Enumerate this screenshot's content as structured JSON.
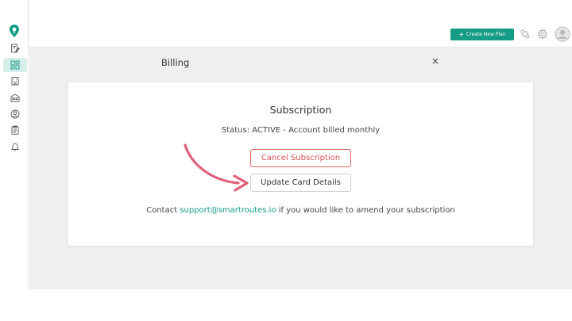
{
  "topbar": {
    "create_button_label": "Create New Plan"
  },
  "panel": {
    "title": "Billing",
    "close_glyph": "×"
  },
  "subscription": {
    "title": "Subscription",
    "status": "Status: ACTIVE - Account billed monthly",
    "cancel_label": "Cancel Subscription",
    "update_label": "Update Card Details",
    "contact_prefix": "Contact ",
    "contact_email": "support@smartroutes.io",
    "contact_suffix": " if you would like to amend your subscription"
  },
  "colors": {
    "accent": "#169c86",
    "danger": "#dd4f4f",
    "annotation_arrow": "#e0607a",
    "nav_active_bg": "#d6eeea"
  },
  "sidebar": {
    "items": [
      {
        "icon": "edit-document-icon",
        "active": false
      },
      {
        "icon": "dashboard-grid-icon",
        "active": true
      },
      {
        "icon": "building-icon",
        "active": false
      },
      {
        "icon": "warehouse-icon",
        "active": false
      },
      {
        "icon": "user-circle-icon",
        "active": false
      },
      {
        "icon": "clipboard-icon",
        "active": false
      },
      {
        "icon": "bell-icon",
        "active": false
      }
    ]
  }
}
